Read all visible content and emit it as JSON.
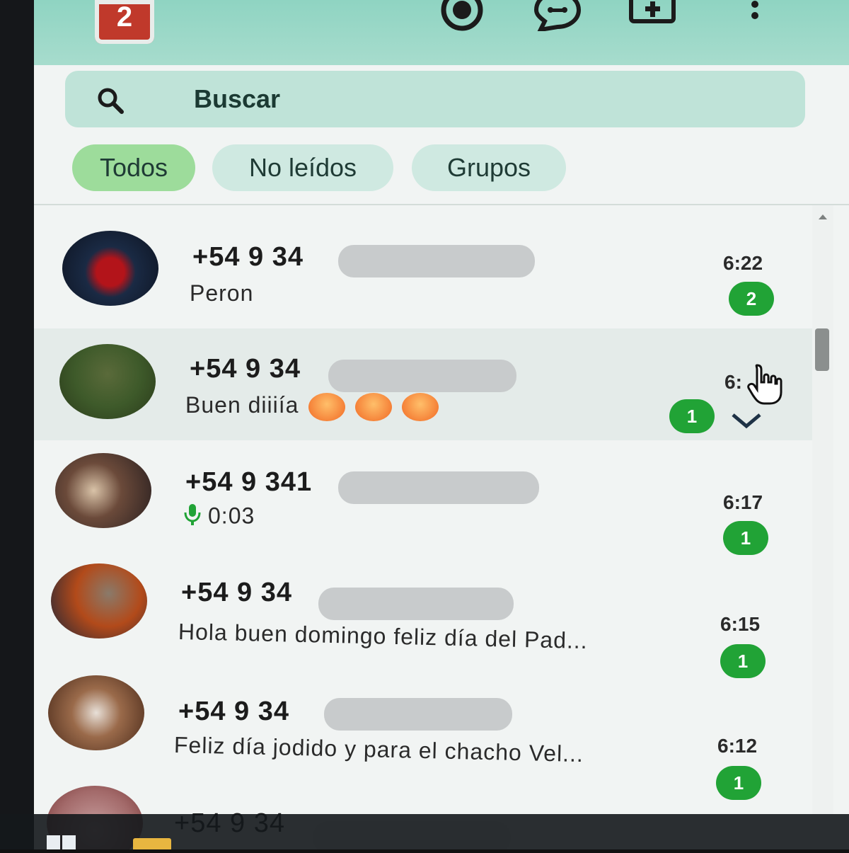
{
  "header": {
    "app_badge": "2",
    "icons": [
      "status-icon",
      "channels-icon",
      "new-chat-icon",
      "more-menu-icon"
    ]
  },
  "search": {
    "placeholder": "Buscar"
  },
  "filters": [
    {
      "label": "Todos",
      "active": true
    },
    {
      "label": "No leídos",
      "active": false
    },
    {
      "label": "Grupos",
      "active": false
    }
  ],
  "chats": [
    {
      "name": "+54 9 34",
      "preview": "Peron",
      "time": "6:22",
      "unread": "2"
    },
    {
      "name": "+54 9 34",
      "preview": "Buen  diiiía",
      "time": "6:",
      "unread": "1"
    },
    {
      "name": "+54 9 341",
      "preview": "0:03",
      "time": "6:17",
      "unread": "1"
    },
    {
      "name": "+54 9 34",
      "preview": "Hola buen domingo feliz día del Pad...",
      "time": "6:15",
      "unread": "1"
    },
    {
      "name": "+54 9 34",
      "preview": "Feliz día jodido y para el chacho Vel...",
      "time": "6:12",
      "unread": "1"
    },
    {
      "name": "+54 9 34",
      "preview": "",
      "time": "",
      "unread": ""
    }
  ],
  "colors": {
    "accent": "#21a336",
    "header": "#a7dccd",
    "chip_active": "#9ddc9b"
  }
}
